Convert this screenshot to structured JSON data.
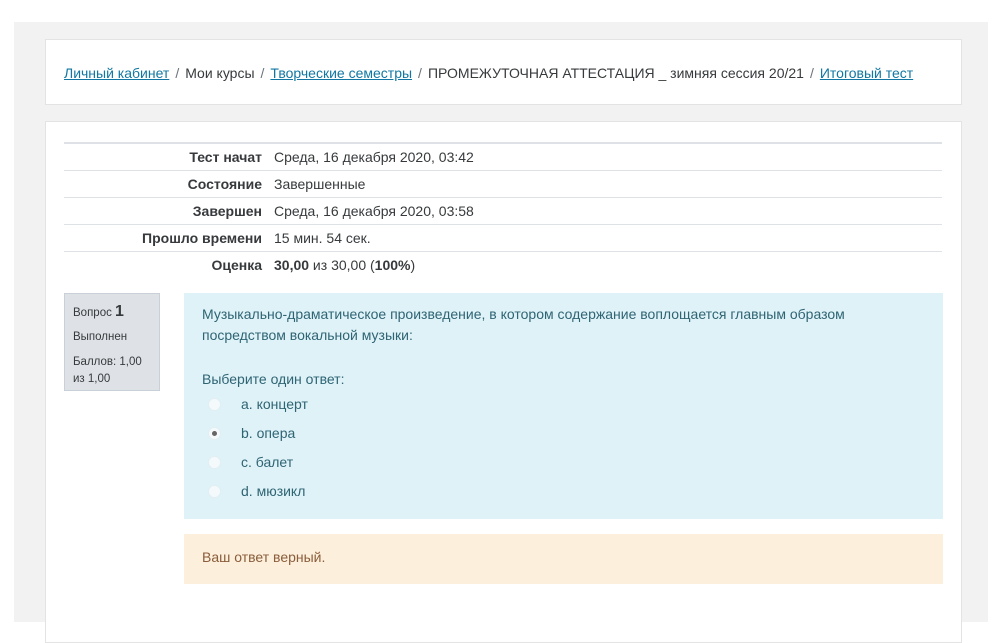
{
  "breadcrumb": [
    {
      "label": "Личный кабинет",
      "link": true
    },
    {
      "label": "Мои курсы",
      "link": false
    },
    {
      "label": "Творческие семестры",
      "link": true
    },
    {
      "label": "ПРОМЕЖУТОЧНАЯ АТТЕСТАЦИЯ _ зимняя сессия 20/21",
      "link": false
    },
    {
      "label": "Итоговый тест",
      "link": true
    }
  ],
  "summary": {
    "started_label": "Тест начат",
    "started": "Среда, 16 декабря 2020, 03:42",
    "state_label": "Состояние",
    "state": "Завершенные",
    "finished_label": "Завершен",
    "finished": "Среда, 16 декабря 2020, 03:58",
    "elapsed_label": "Прошло времени",
    "elapsed": "15 мин. 54 сек.",
    "grade_label": "Оценка",
    "grade_score": "30,00",
    "grade_mid": " из 30,00 (",
    "grade_percent": "100%",
    "grade_end": ")"
  },
  "question": {
    "label": "Вопрос",
    "number": "1",
    "status": "Выполнен",
    "marks": "Баллов: 1,00 из 1,00",
    "text": "Музыкально-драматическое произведение, в котором содержание воплощается главным образом посредством вокальной музыки:",
    "prompt": "Выберите один ответ:",
    "options": [
      {
        "label": "a. концерт",
        "selected": false
      },
      {
        "label": "b. опера",
        "selected": true
      },
      {
        "label": "c. балет",
        "selected": false
      },
      {
        "label": "d. мюзикл",
        "selected": false
      }
    ],
    "feedback": "Ваш ответ верный."
  }
}
